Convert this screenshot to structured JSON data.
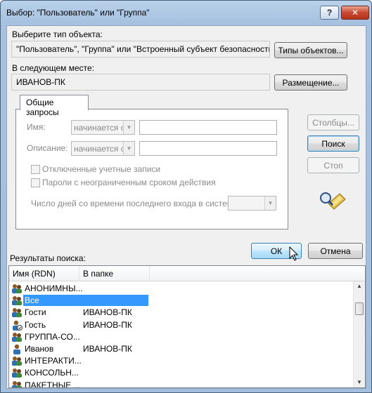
{
  "window": {
    "title": "Выбор: \"Пользователь\" или \"Группа\"",
    "help_label": "?",
    "close_label": "✕"
  },
  "object_type": {
    "label": "Выберите тип объекта:",
    "value": "\"Пользователь\", \"Группа\" или \"Встроенный субъект безопасности\"",
    "button": "Типы объектов..."
  },
  "location": {
    "label": "В следующем месте:",
    "value": "ИВАНОВ-ПК",
    "button": "Размещение..."
  },
  "query": {
    "tab": "Общие запросы",
    "name_label": "Имя:",
    "name_mode": "начинается с",
    "desc_label": "Описание:",
    "desc_mode": "начинается с",
    "disabled_accounts": "Отключенные учетные записи",
    "nonexpiring_passwords": "Пароли с неограниченным сроком действия",
    "days_label": "Число дней со времени последнего входа в систему:"
  },
  "side_buttons": {
    "columns": "Столбцы...",
    "search": "Поиск",
    "stop": "Стоп"
  },
  "results": {
    "label": "Результаты поиска:",
    "col_name": "Имя (RDN)",
    "col_folder": "В папке",
    "rows": [
      {
        "name": "АНОНИМНЫ...",
        "folder": "",
        "icon": "group-icon"
      },
      {
        "name": "Все",
        "folder": "",
        "icon": "group-icon",
        "selected": true
      },
      {
        "name": "Гости",
        "folder": "ИВАНОВ-ПК",
        "icon": "group-icon"
      },
      {
        "name": "Гость",
        "folder": "ИВАНОВ-ПК",
        "icon": "user-disabled-icon"
      },
      {
        "name": "ГРУППА-СО...",
        "folder": "",
        "icon": "group-icon"
      },
      {
        "name": "Иванов",
        "folder": "ИВАНОВ-ПК",
        "icon": "user-icon"
      },
      {
        "name": "ИНТЕРАКТИ...",
        "folder": "",
        "icon": "group-icon"
      },
      {
        "name": "КОНСОЛЬН...",
        "folder": "",
        "icon": "group-icon"
      },
      {
        "name": "ПАКЕТНЫЕ ...",
        "folder": "",
        "icon": "group-icon"
      }
    ]
  },
  "footer": {
    "ok": "ОК",
    "cancel": "Отмена"
  }
}
